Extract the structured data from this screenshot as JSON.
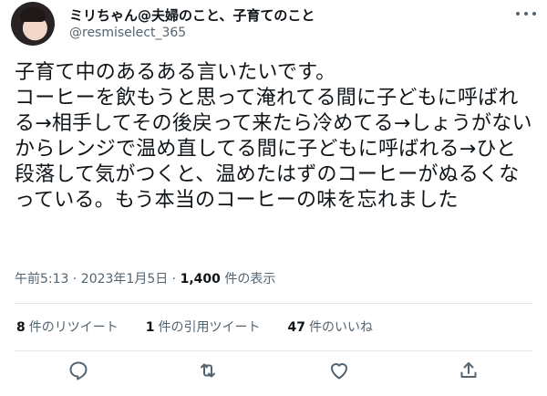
{
  "author": {
    "display_name": "ミリちゃん@夫婦のこと、子育てのこと",
    "handle": "@resmiselect_365"
  },
  "tweet": {
    "text": "子育て中のあるある言いたいです。\nコーヒーを飲もうと思って淹れてる間に子どもに呼ばれる→相手してその後戻って来たら冷めてる→しょうがないからレンジで温め直してる間に子どもに呼ばれる→ひと段落して気がつくと、温めたはずのコーヒーがぬるくなっている。もう本当のコーヒーの味を忘れました",
    "time": "午前5:13 · 2023年1月5日 · ",
    "views_count": "1,400",
    "views_label": " 件の表示"
  },
  "stats": {
    "retweets_count": "8",
    "retweets_label": "件のリツイート",
    "quotes_count": "1",
    "quotes_label": "件の引用ツイート",
    "likes_count": "47",
    "likes_label": "件のいいね"
  },
  "icons": {
    "more": "more-icon",
    "reply": "reply-icon",
    "retweet": "retweet-icon",
    "like": "like-icon",
    "share": "share-icon"
  },
  "colors": {
    "text": "#0f1419",
    "secondary": "#536471",
    "divider": "#e1e8ed"
  }
}
